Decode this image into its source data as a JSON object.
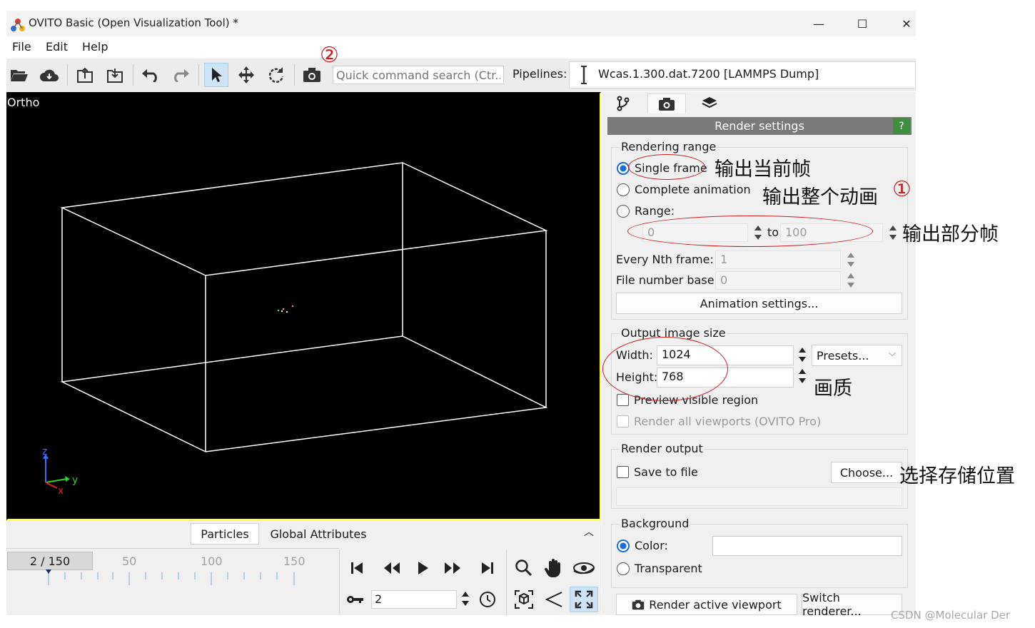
{
  "window": {
    "title": "OVITO Basic (Open Visualization Tool) *",
    "minimize": "—",
    "maximize": "☐",
    "close": "✕"
  },
  "menu": [
    "File",
    "Edit",
    "Help"
  ],
  "toolbar": {
    "search_placeholder": "Quick command search (Ctr...",
    "pipelines_label": "Pipelines:",
    "pipeline_name": "Wcas.1.300.dat.7200 [LAMMPS Dump]"
  },
  "viewport": {
    "label": "Ortho"
  },
  "bottom_tabs": [
    "Particles",
    "Global Attributes"
  ],
  "timeline": {
    "frame_indicator": "2 / 150",
    "tick_labels": [
      "50",
      "100",
      "150"
    ],
    "current_frame": "2"
  },
  "render": {
    "header": "Render settings",
    "help": "?",
    "rendering_range": {
      "title": "Rendering range",
      "single_frame": "Single frame",
      "complete_animation": "Complete animation",
      "range": "Range:",
      "range_from": "0",
      "range_to_label": "to",
      "range_to": "100",
      "every_nth_label": "Every Nth frame:",
      "every_nth_value": "1",
      "file_base_label": "File number base:",
      "file_base_value": "0",
      "animation_settings": "Animation settings..."
    },
    "output_size": {
      "title": "Output image size",
      "width_label": "Width:",
      "width": "1024",
      "height_label": "Height:",
      "height": "768",
      "presets": "Presets...",
      "preview_visible": "Preview visible region",
      "render_all": "Render all viewports (OVITO Pro)"
    },
    "render_output": {
      "title": "Render output",
      "save_to_file": "Save to file",
      "choose": "Choose..."
    },
    "background": {
      "title": "Background",
      "color": "Color:",
      "transparent": "Transparent"
    },
    "render_active": "Render active viewport",
    "switch_renderer": "Switch renderer..."
  },
  "annotations": {
    "single_frame_note": "输出当前帧",
    "complete_animation_note": "输出整个动画",
    "circle_one": "①",
    "circle_two": "②",
    "range_note": "输出部分帧",
    "size_note": "画质",
    "choose_note": "选择存储位置"
  },
  "watermark": "CSDN @Molecular Der",
  "colors": {
    "viewport_border": "#ffff33",
    "accent": "#1a6fd0",
    "annotation_red": "#d11a1a",
    "help_green": "#3f8f3f"
  }
}
